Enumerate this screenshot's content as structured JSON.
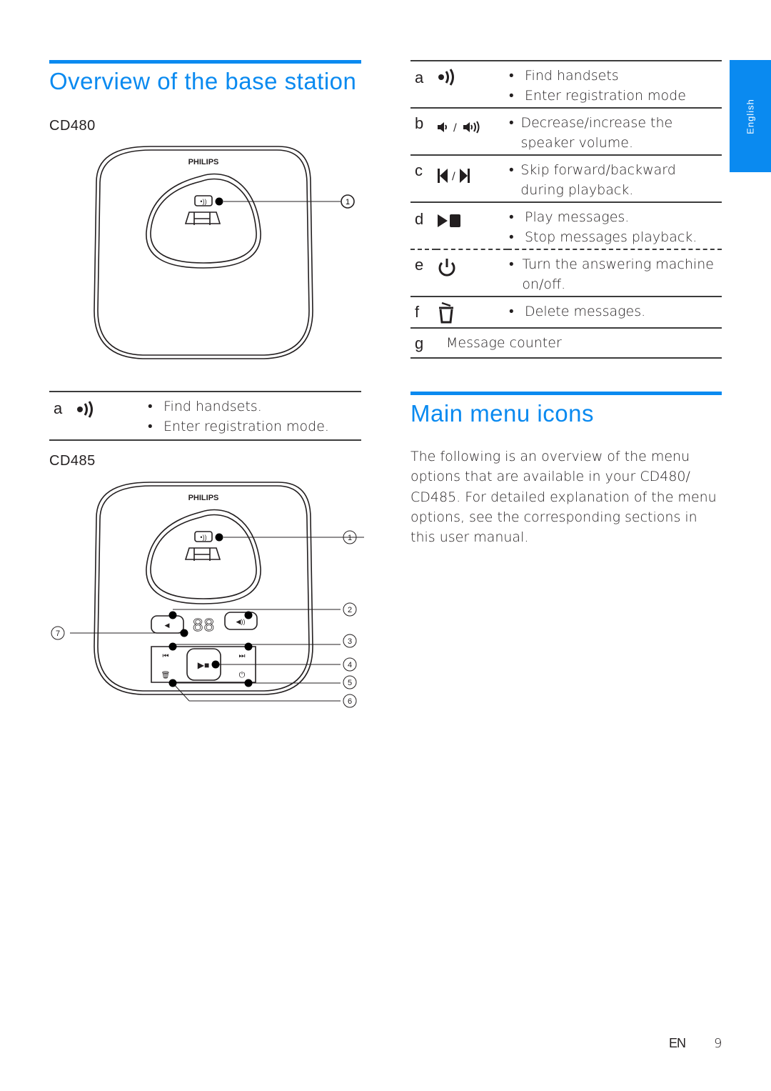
{
  "left": {
    "title": "Overview of the base station",
    "cd480": {
      "model": "CD480",
      "brand": "PHILIPS",
      "callouts": [
        "1"
      ]
    },
    "cd480_table": [
      {
        "letter": "a",
        "icon": "find-handset-icon",
        "bullets": [
          "Find handsets.",
          "Enter registration mode."
        ]
      }
    ],
    "cd485": {
      "model": "CD485",
      "brand": "PHILIPS",
      "callouts": [
        "1",
        "2",
        "3",
        "4",
        "5",
        "6",
        "7"
      ]
    }
  },
  "right": {
    "table": [
      {
        "letter": "a",
        "icon": "find-handset-icon",
        "bullets": [
          "Find handsets",
          "Enter registration mode"
        ]
      },
      {
        "letter": "b",
        "icon": "volume-down-up-icon",
        "bullets": [
          "Decrease/increase the speaker volume."
        ]
      },
      {
        "letter": "c",
        "icon": "skip-back-forward-icon",
        "bullets": [
          "Skip forward/backward during playback."
        ]
      },
      {
        "letter": "d",
        "icon": "play-stop-icon",
        "bullets": [
          "Play messages.",
          "Stop messages playback."
        ]
      },
      {
        "letter": "e",
        "icon": "power-icon",
        "bullets": [
          "Turn the answering machine on/off."
        ]
      },
      {
        "letter": "f",
        "icon": "trash-icon",
        "bullets": [
          "Delete messages."
        ]
      },
      {
        "letter": "g",
        "text": "Message counter"
      }
    ],
    "section_title": "Main menu icons",
    "paragraph": "The following is an overview of the menu options that are available in your CD480/ CD485. For detailed explanation of the menu options, see the corresponding sections in this user manual."
  },
  "sidebar": {
    "language": "English",
    "color": "#0a8af0"
  },
  "footer": {
    "lang": "EN",
    "page": "9"
  },
  "colors": {
    "accent": "#0a8af0",
    "text": "#231f20"
  }
}
